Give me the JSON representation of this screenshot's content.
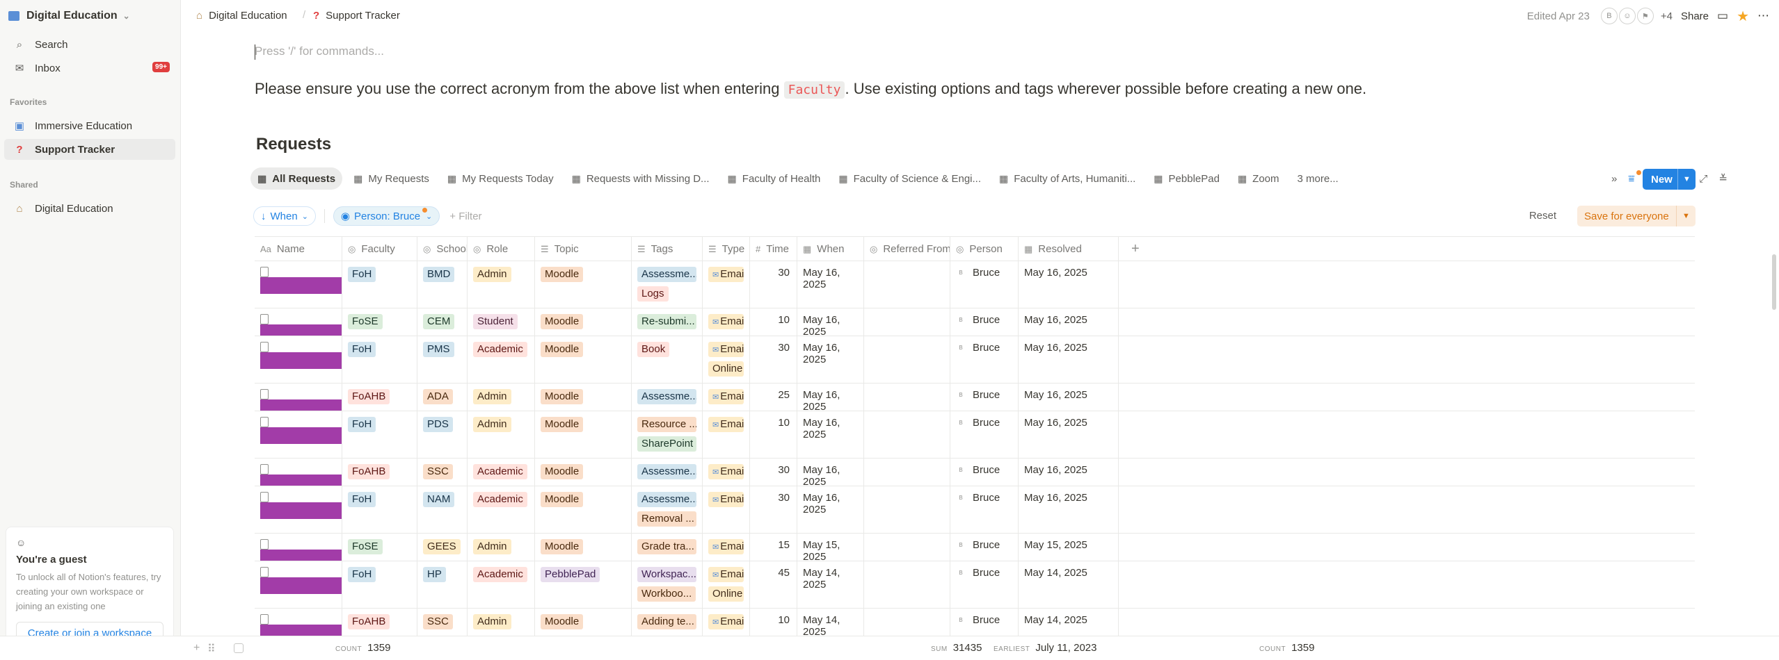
{
  "sidebar": {
    "workspace": "Digital Education",
    "search": "Search",
    "inbox": "Inbox",
    "inbox_badge": "99+",
    "favorites_label": "Favorites",
    "favorites": [
      "Immersive Education",
      "Support Tracker"
    ],
    "shared_label": "Shared",
    "shared": [
      "Digital Education"
    ],
    "guest": {
      "title": "You're a guest",
      "text": "To unlock all of Notion's features, try creating your own workspace or joining an existing one",
      "button": "Create or join a workspace"
    }
  },
  "topbar": {
    "breadcrumb": [
      "Digital Education",
      "Support Tracker"
    ],
    "edited": "Edited Apr 23",
    "avatars": [
      "B",
      "",
      ""
    ],
    "more_count": "+4",
    "share": "Share"
  },
  "page": {
    "placeholder": "Press '/' for commands...",
    "para_before": "Please ensure you use the correct acronym from the above list when entering ",
    "para_code": "Faculty",
    "para_after": ". Use existing options and tags wherever possible before creating a new one.",
    "db_title": "Requests"
  },
  "views": [
    "All Requests",
    "My Requests",
    "My Requests Today",
    "Requests with Missing D...",
    "Faculty of Health",
    "Faculty of Science & Engi...",
    "Faculty of Arts, Humaniti...",
    "PebblePad",
    "Zoom",
    "3 more..."
  ],
  "new_button": "New",
  "filters": {
    "when": "When",
    "person": "Person: Bruce",
    "add": "Filter",
    "reset": "Reset",
    "save": "Save for everyone"
  },
  "columns": [
    "Name",
    "Faculty",
    "School/...",
    "Role",
    "Topic",
    "Tags",
    "Type",
    "Time",
    "When",
    "Referred From",
    "Person",
    "Resolved"
  ],
  "rows": [
    {
      "faculty": "FoH",
      "school": "BMD",
      "role": "Admin",
      "topic": "Moodle",
      "tags": [
        "Assessme...",
        "Logs"
      ],
      "type": [
        "Email"
      ],
      "time": "30",
      "when": "May 16, 2025",
      "person": "Bruce",
      "resolved": "May 16, 2025"
    },
    {
      "faculty": "FoSE",
      "school": "CEM",
      "role": "Student",
      "topic": "Moodle",
      "tags": [
        "Re-submi..."
      ],
      "type": [
        "Email"
      ],
      "time": "10",
      "when": "May 16, 2025",
      "person": "Bruce",
      "resolved": "May 16, 2025"
    },
    {
      "faculty": "FoH",
      "school": "PMS",
      "role": "Academic",
      "topic": "Moodle",
      "tags": [
        "Book"
      ],
      "type": [
        "Email",
        "Online [Z..."
      ],
      "time": "30",
      "when": "May 16, 2025",
      "person": "Bruce",
      "resolved": "May 16, 2025"
    },
    {
      "faculty": "FoAHB",
      "school": "ADA",
      "role": "Admin",
      "topic": "Moodle",
      "tags": [
        "Assessme..."
      ],
      "type": [
        "Email"
      ],
      "time": "25",
      "when": "May 16, 2025",
      "person": "Bruce",
      "resolved": "May 16, 2025"
    },
    {
      "faculty": "FoH",
      "school": "PDS",
      "role": "Admin",
      "topic": "Moodle",
      "tags": [
        "Resource ...",
        "SharePoint"
      ],
      "type": [
        "Email"
      ],
      "time": "10",
      "when": "May 16, 2025",
      "person": "Bruce",
      "resolved": "May 16, 2025"
    },
    {
      "faculty": "FoAHB",
      "school": "SSC",
      "role": "Academic",
      "topic": "Moodle",
      "tags": [
        "Assessme..."
      ],
      "type": [
        "Email"
      ],
      "time": "30",
      "when": "May 16, 2025",
      "person": "Bruce",
      "resolved": "May 16, 2025"
    },
    {
      "faculty": "FoH",
      "school": "NAM",
      "role": "Academic",
      "topic": "Moodle",
      "tags": [
        "Assessme...",
        "Removal ..."
      ],
      "type": [
        "Email"
      ],
      "time": "30",
      "when": "May 16, 2025",
      "person": "Bruce",
      "resolved": "May 16, 2025"
    },
    {
      "faculty": "FoSE",
      "school": "GEES",
      "role": "Admin",
      "topic": "Moodle",
      "tags": [
        "Grade tra..."
      ],
      "type": [
        "Email"
      ],
      "time": "15",
      "when": "May 15, 2025",
      "person": "Bruce",
      "resolved": "May 15, 2025"
    },
    {
      "faculty": "FoH",
      "school": "HP",
      "role": "Academic",
      "topic": "PebblePad",
      "tags": [
        "Workspac...",
        "Workboo..."
      ],
      "type": [
        "Email",
        "Online [Z..."
      ],
      "time": "45",
      "when": "May 14, 2025",
      "person": "Bruce",
      "resolved": "May 14, 2025"
    },
    {
      "faculty": "FoAHB",
      "school": "SSC",
      "role": "Admin",
      "topic": "Moodle",
      "tags": [
        "Adding te..."
      ],
      "type": [
        "Email"
      ],
      "time": "10",
      "when": "May 14, 2025",
      "person": "Bruce",
      "resolved": "May 14, 2025"
    }
  ],
  "footer": {
    "count_label": "COUNT",
    "count": "1359",
    "sum_label": "SUM",
    "sum": "31435",
    "earliest_label": "EARLIEST",
    "earliest": "July 11, 2023",
    "count2_label": "COUNT",
    "count2": "1359"
  },
  "colors": {
    "accent": "#2383e2",
    "redaction": "#a23ca8",
    "badge": "#e03e3e",
    "save_bg": "#fbecdd",
    "save_text": "#d9730d"
  }
}
